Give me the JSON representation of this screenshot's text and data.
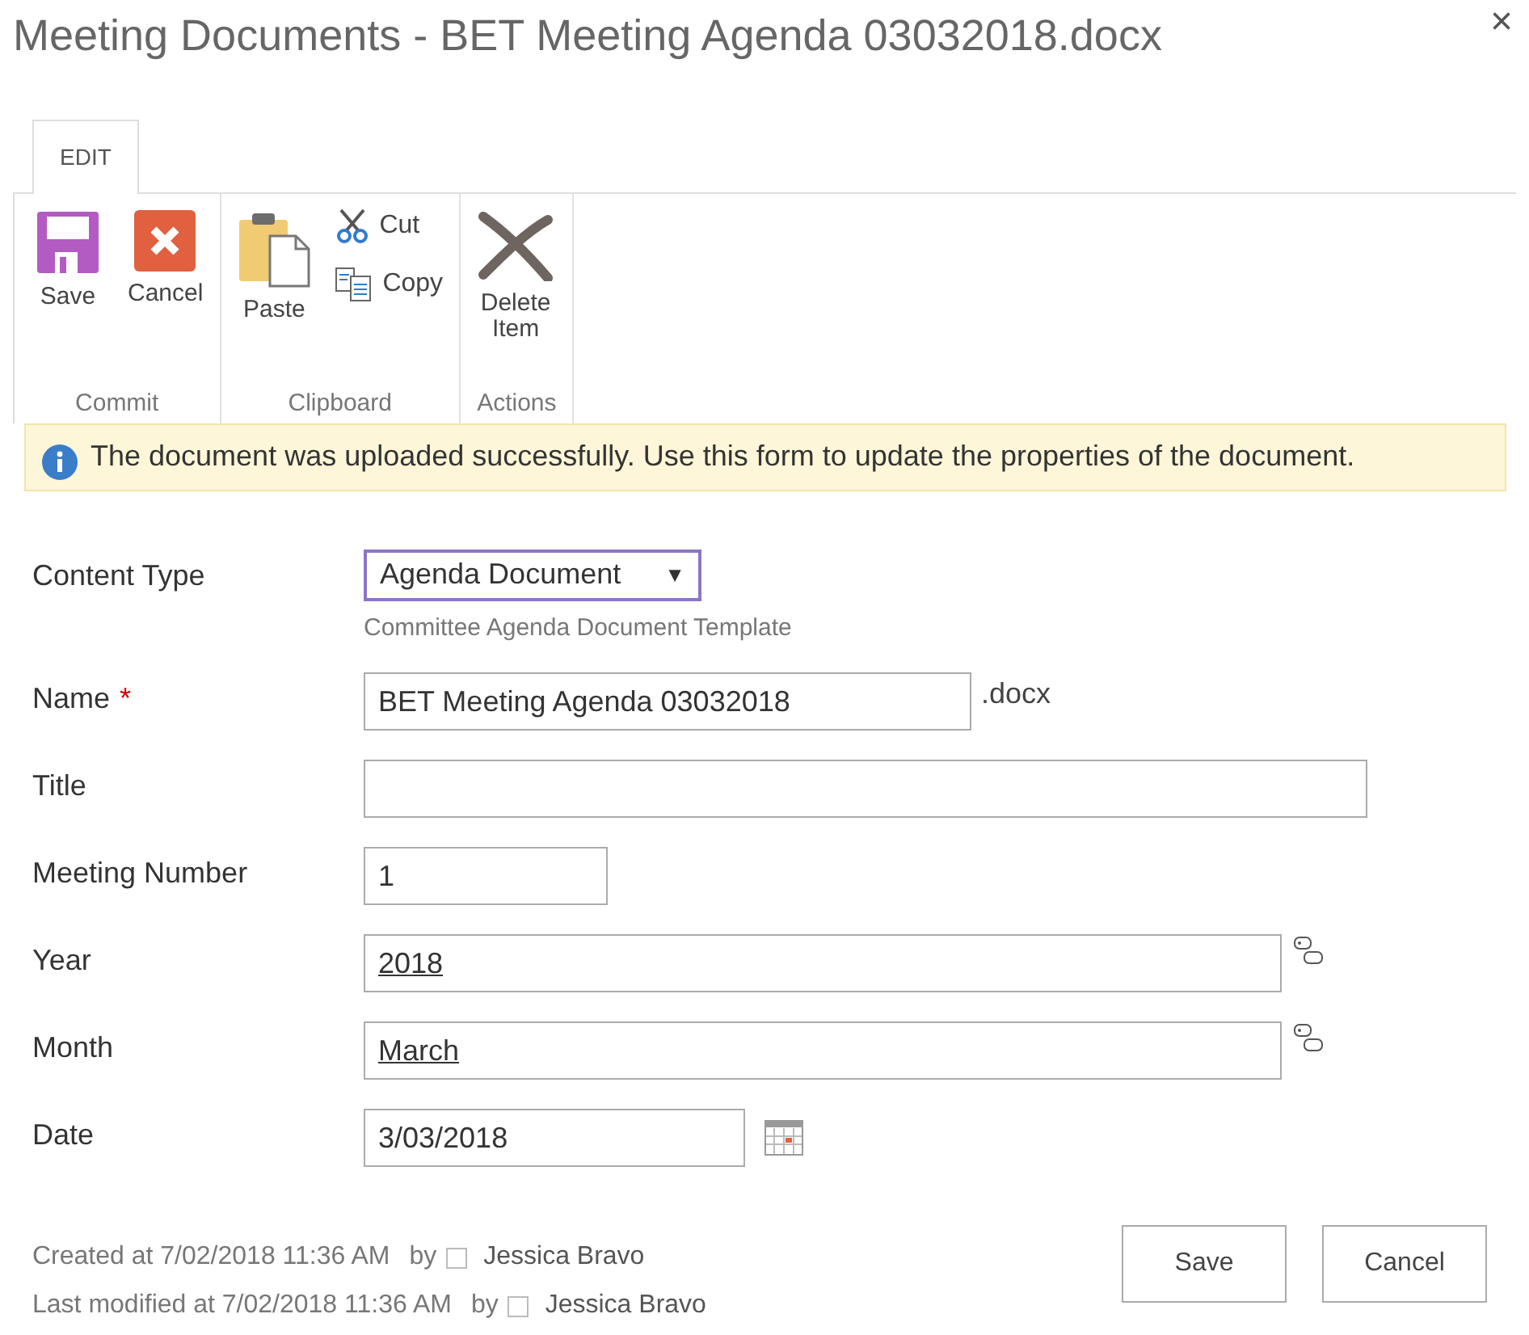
{
  "window": {
    "title": "Meeting Documents - BET Meeting Agenda 03032018.docx",
    "close": "×"
  },
  "tabs": [
    {
      "label": "EDIT",
      "selected": true
    }
  ],
  "ribbon_groups": [
    {
      "label": "Commit",
      "items": [
        {
          "kind": "save",
          "label": "Save"
        },
        {
          "kind": "cancel",
          "label": "Cancel"
        }
      ]
    },
    {
      "label": "Clipboard",
      "items": [
        {
          "kind": "paste",
          "label": "Paste"
        },
        {
          "kind": "cut",
          "label": "Cut"
        },
        {
          "kind": "copy",
          "label": "Copy"
        }
      ]
    },
    {
      "label": "Actions",
      "items": [
        {
          "kind": "delete",
          "label": "Delete Item"
        }
      ]
    }
  ],
  "message": "The document was uploaded successfully. Use this form to update the properties of the document.",
  "fields": [
    {
      "kind": "select",
      "label": "Content Type",
      "value": "Agenda Document",
      "caret": "▼",
      "hint": "Committee Agenda Document Template"
    },
    {
      "kind": "name",
      "label": "Name",
      "required": true,
      "required_mark": "*",
      "value": "BET Meeting Agenda 03032018",
      "suffix": ".docx"
    },
    {
      "kind": "wide",
      "label": "Title"
    },
    {
      "kind": "short",
      "label": "Meeting Number",
      "value": "1"
    },
    {
      "kind": "term",
      "label": "Year",
      "value": "2018"
    },
    {
      "kind": "term",
      "label": "Month",
      "value": "March"
    },
    {
      "kind": "date",
      "label": "Date",
      "value": "3/03/2018"
    }
  ],
  "footer": {
    "created": "Created at 7/02/2018 11:36 AM",
    "created_by_label": "by",
    "created_by": "Jessica Bravo",
    "modified": "Last modified at 7/02/2018 11:36 AM",
    "modified_by_label": "by",
    "modified_by": "Jessica Bravo"
  },
  "buttons": [
    "Save",
    "Cancel"
  ]
}
